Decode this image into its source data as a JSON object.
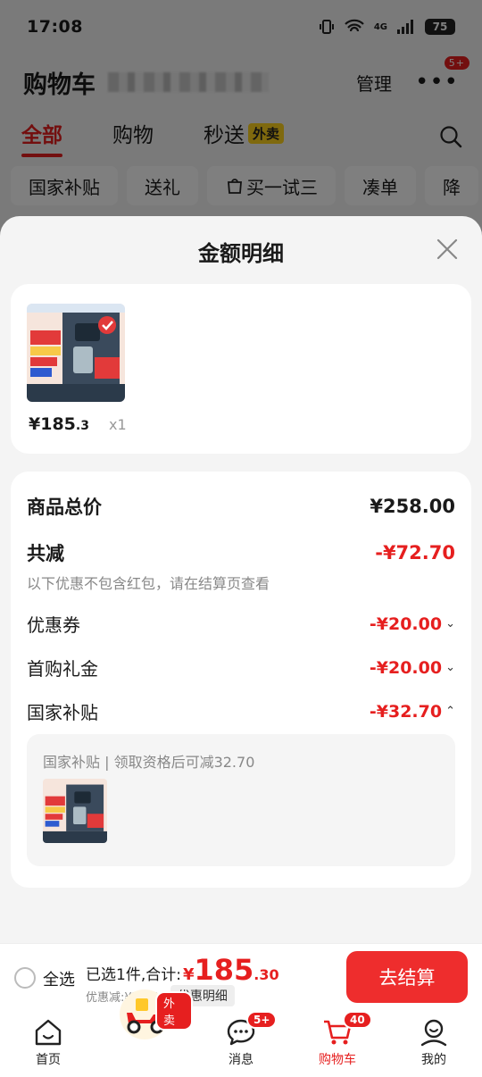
{
  "status_bar": {
    "time": "17:08",
    "battery": "75",
    "network": "4G"
  },
  "header": {
    "title": "购物车",
    "manage_label": "管理",
    "more_badge": "5+"
  },
  "top_tabs": [
    {
      "label": "全部",
      "active": true
    },
    {
      "label": "购物",
      "active": false
    },
    {
      "label": "秒送",
      "tag": "外卖",
      "active": false
    }
  ],
  "chips": [
    "国家补贴",
    "送礼",
    "买一试三",
    "凑单",
    "降"
  ],
  "sheet": {
    "title": "金额明细",
    "product": {
      "price_int": "¥185",
      "price_dec": ".3",
      "qty": "x1"
    },
    "detail": {
      "total_label": "商品总价",
      "total_value": "¥258.00",
      "reduce_label": "共减",
      "reduce_value": "-¥72.70",
      "reduce_note": "以下优惠不包含红包，请在结算页查看",
      "items": [
        {
          "label": "优惠券",
          "value": "-¥20.00",
          "chevron": "down"
        },
        {
          "label": "首购礼金",
          "value": "-¥20.00",
          "chevron": "down"
        },
        {
          "label": "国家补贴",
          "value": "-¥32.70",
          "chevron": "up"
        }
      ],
      "subsidy_text": "国家补贴 | 领取资格后可减32.70"
    }
  },
  "checkout": {
    "select_all": "全选",
    "selected_text": "已选1件,合计:",
    "yen": "¥",
    "sum_int": "185",
    "sum_dec": ".30",
    "discount_text": "优惠减:¥72.70",
    "discount_detail_btn": "优惠明细",
    "checkout_btn": "去结算"
  },
  "tab_bar": [
    {
      "label": "首页",
      "icon": "home-icon"
    },
    {
      "label": "",
      "icon": "scooter-icon",
      "badge": "外卖"
    },
    {
      "label": "消息",
      "icon": "message-icon",
      "badge": "5+"
    },
    {
      "label": "购物车",
      "icon": "cart-icon",
      "badge": "40",
      "active": true
    },
    {
      "label": "我的",
      "icon": "user-icon"
    }
  ],
  "colors": {
    "accent": "#e61f1f",
    "tag_yellow": "#ffd21c"
  }
}
